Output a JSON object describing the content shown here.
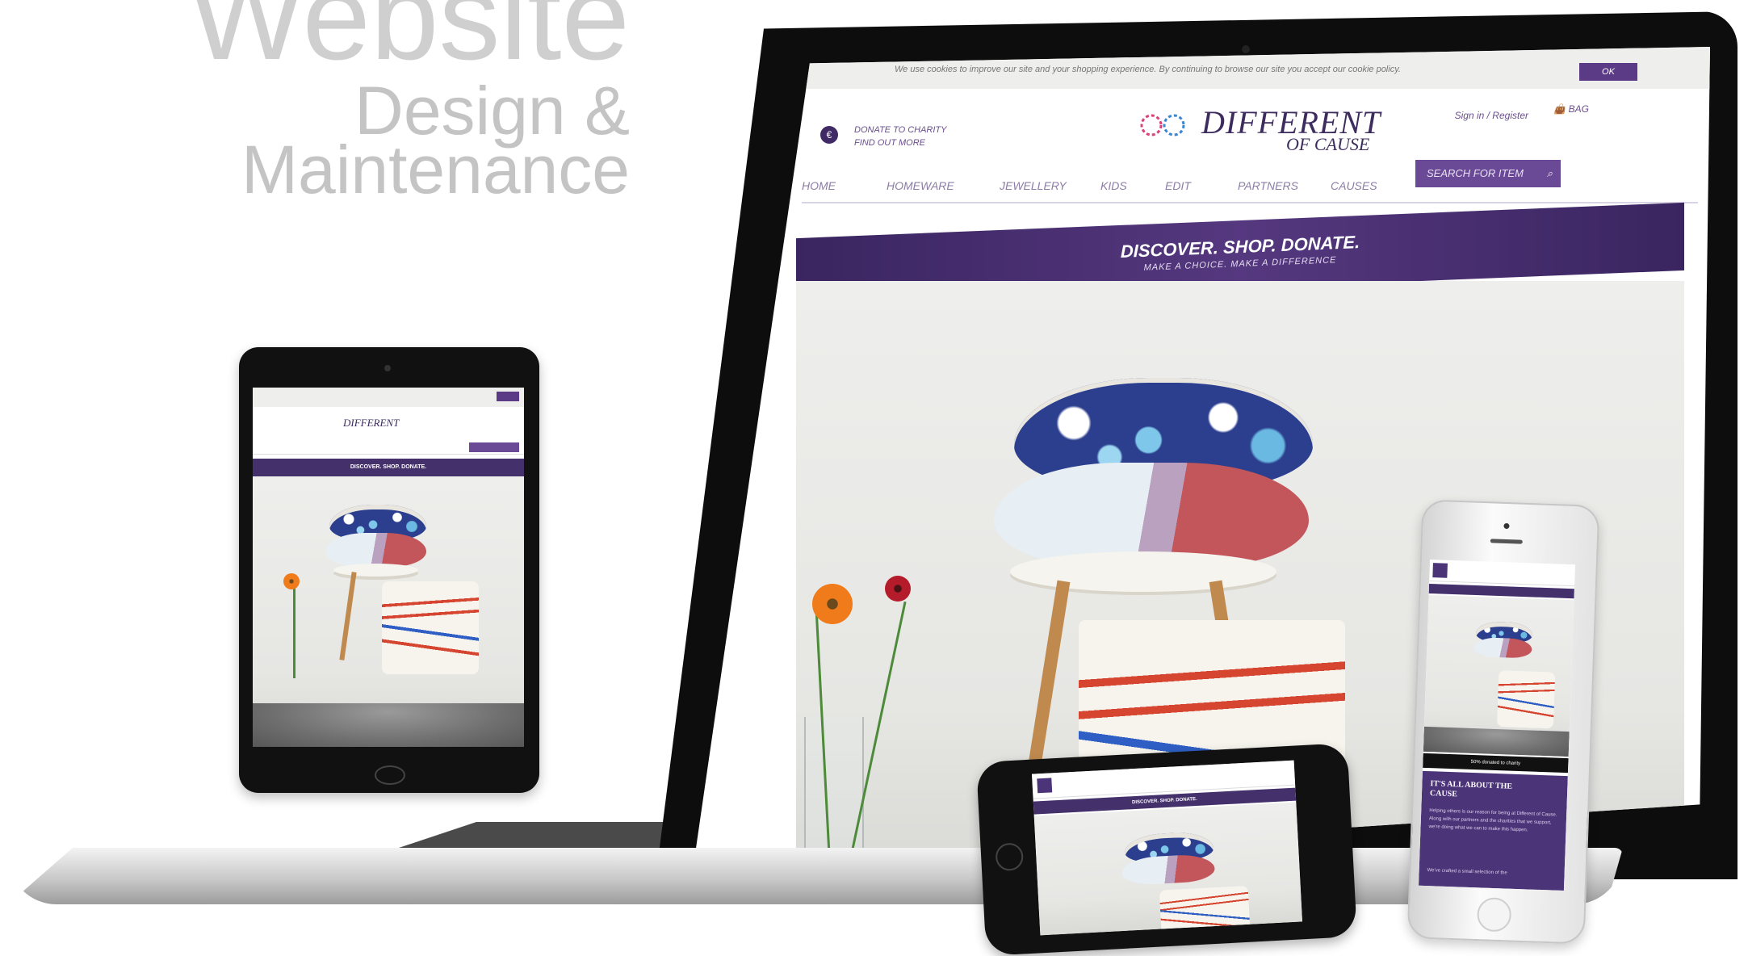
{
  "heading": {
    "line1": "Website",
    "line2": "Design &",
    "line3": "Maintenance"
  },
  "site": {
    "cookie_notice": "We use cookies to improve our site and your shopping experience. By continuing to browse our site you accept our cookie policy.",
    "cookie_ok": "OK",
    "donate_line1": "DONATE TO CHARITY",
    "donate_line2": "FIND OUT MORE",
    "donate_badge": "€",
    "logo_main": "DIFFERENT",
    "logo_sub": "OF CAUSE",
    "sign_in": "Sign in / Register",
    "bag": "BAG",
    "nav": [
      "HOME",
      "HOMEWARE",
      "JEWELLERY",
      "KIDS",
      "EDIT",
      "PARTNERS",
      "CAUSES"
    ],
    "search_placeholder": "SEARCH FOR ITEM",
    "banner_title": "DISCOVER. SHOP. DONATE.",
    "banner_subtitle": "MAKE A CHOICE. MAKE A DIFFERENCE"
  },
  "mobile": {
    "strip": "50% donated to charity",
    "panel_title": "IT'S ALL ABOUT THE CAUSE",
    "panel_body": "Helping others is our reason for being at Different of Cause. Along with our partners and the charities that we support, we're doing what we can to make this happen.",
    "panel_more": "We've crafted a small selection of the"
  },
  "colors": {
    "brand_purple": "#4b3477",
    "heading_gray": "#c4c4c4"
  }
}
